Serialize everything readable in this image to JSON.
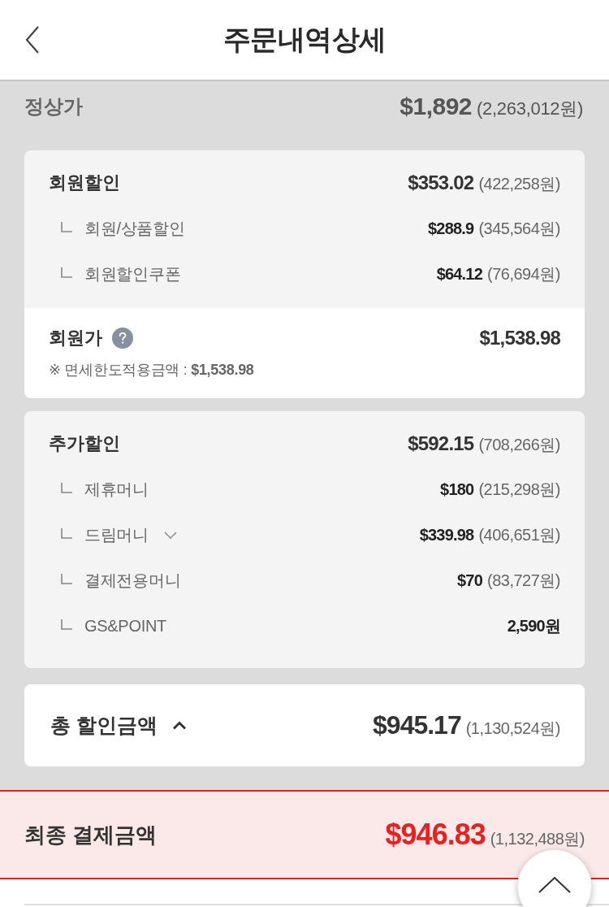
{
  "header": {
    "title": "주문내역상세"
  },
  "regular_price": {
    "label": "정상가",
    "usd": "$1,892",
    "krw": "(2,263,012원)"
  },
  "member_discount": {
    "label": "회원할인",
    "usd": "$353.02",
    "krw": "(422,258원)",
    "items": [
      {
        "label": "회원/상품할인",
        "usd": "$288.9",
        "krw": "(345,564원)"
      },
      {
        "label": "회원할인쿠폰",
        "usd": "$64.12",
        "krw": "(76,694원)"
      }
    ]
  },
  "member_price": {
    "label": "회원가",
    "usd": "$1,538.98",
    "note": "※ 면세한도적용금액 : **$1,538.98**"
  },
  "additional_discount": {
    "label": "추가할인",
    "usd": "$592.15",
    "krw": "(708,266원)",
    "items": [
      {
        "kind": "plain",
        "label": "제휴머니",
        "usd": "$180",
        "krw": "(215,298원)"
      },
      {
        "kind": "expandable",
        "label": "드림머니",
        "usd": "$339.98",
        "krw": "(406,651원)"
      },
      {
        "kind": "plain",
        "label": "결제전용머니",
        "usd": "$70",
        "krw": "(83,727원)"
      },
      {
        "kind": "points",
        "label": "GS&POINT",
        "amount": "2,590원"
      }
    ]
  },
  "total_discount": {
    "label": "총 할인금액",
    "expanded": true,
    "usd": "$945.17",
    "krw": "(1,130,524원)"
  },
  "final_payment": {
    "label": "최종 결제금액",
    "usd": "$946.83",
    "krw": "(1,132,488원)"
  }
}
